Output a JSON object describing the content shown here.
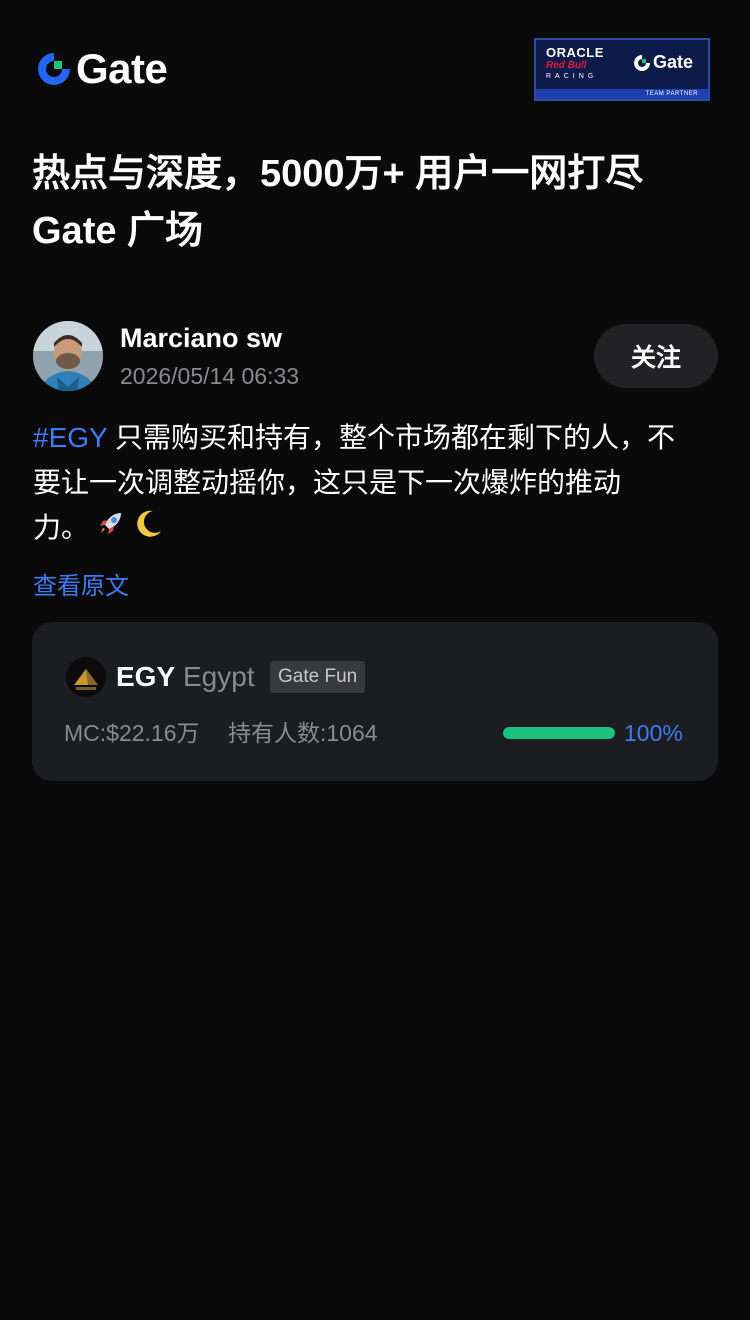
{
  "header": {
    "logo_text": "Gate",
    "partner": {
      "oracle": "ORACLE",
      "redbull": "Red Bull",
      "racing": "RACING",
      "gate_text": "Gate",
      "footer": "TEAM PARTNER"
    }
  },
  "headline": {
    "line1": "热点与深度，5000万+ 用户一网打尽",
    "line2": "Gate 广场"
  },
  "post": {
    "author": "Marciano sw",
    "time": "2026/05/14 06:33",
    "follow_label": "关注",
    "hashtag": "#EGY",
    "line1_text": " 只需购买和持有，整个市场都在剩下的人，不",
    "line2_text": "要让一次调整动摇你，这只是下一次爆炸的推动",
    "line3_text": "力。",
    "view_original": "查看原文"
  },
  "token": {
    "symbol": "EGY",
    "name": "Egypt",
    "tag": "Gate Fun",
    "mc": "MC:$22.16万",
    "holders": "持有人数:1064",
    "progress_label": "100%",
    "progress_value": 1.0
  },
  "colors": {
    "background": "#0a0a0b",
    "accent_blue": "#3d7cf5",
    "progress_green": "#19c37d",
    "card_bg": "#1c1d20"
  },
  "icons": {
    "emoji1": "rocket-icon",
    "emoji2": "crescent-moon-icon"
  }
}
